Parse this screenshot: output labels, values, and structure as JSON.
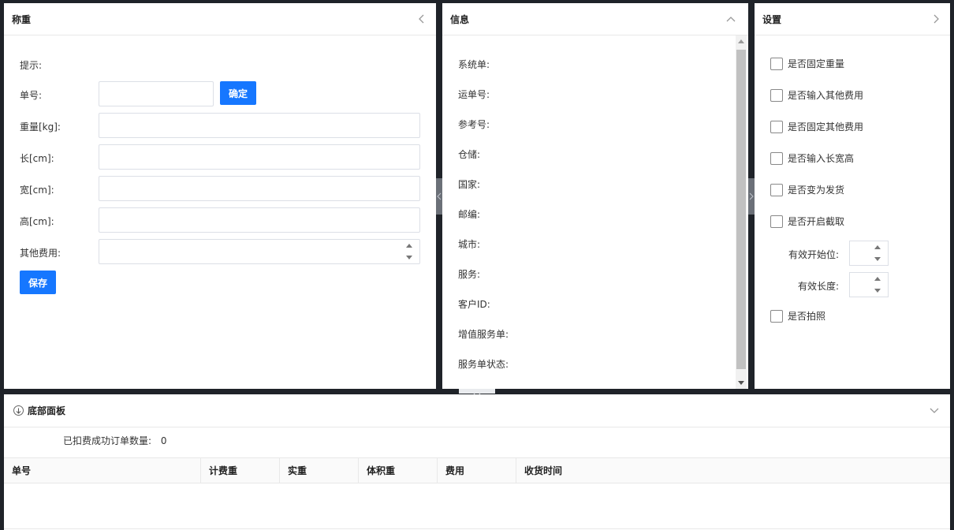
{
  "weigh_panel": {
    "title": "称重",
    "hint_label": "提示:",
    "order_label": "单号:",
    "order_value": "",
    "confirm_label": "确定",
    "weight_label": "重量[kg]:",
    "length_label": "长[cm]:",
    "width_label": "宽[cm]:",
    "height_label": "高[cm]:",
    "other_fee_label": "其他费用:",
    "save_label": "保存"
  },
  "info_panel": {
    "title": "信息",
    "items": [
      "系统单:",
      "运单号:",
      "参考号:",
      "仓储:",
      "国家:",
      "邮编:",
      "城市:",
      "服务:",
      "客户ID:",
      "增值服务单:",
      "服务单状态:"
    ]
  },
  "settings_panel": {
    "title": "设置",
    "options": [
      "是否固定重量",
      "是否输入其他费用",
      "是否固定其他费用",
      "是否输入长宽高",
      "是否变为发货",
      "是否开启截取"
    ],
    "start_label": "有效开始位:",
    "length_label": "有效长度:",
    "photo_label": "是否拍照"
  },
  "bottom_panel": {
    "title": "底部面板",
    "count_label": "已扣费成功订单数量:",
    "count_value": "0",
    "columns": [
      "单号",
      "计费重",
      "实重",
      "体积重",
      "费用",
      "收货时间"
    ]
  },
  "colors": {
    "primary": "#1677ff",
    "divider": "#1f2329"
  }
}
